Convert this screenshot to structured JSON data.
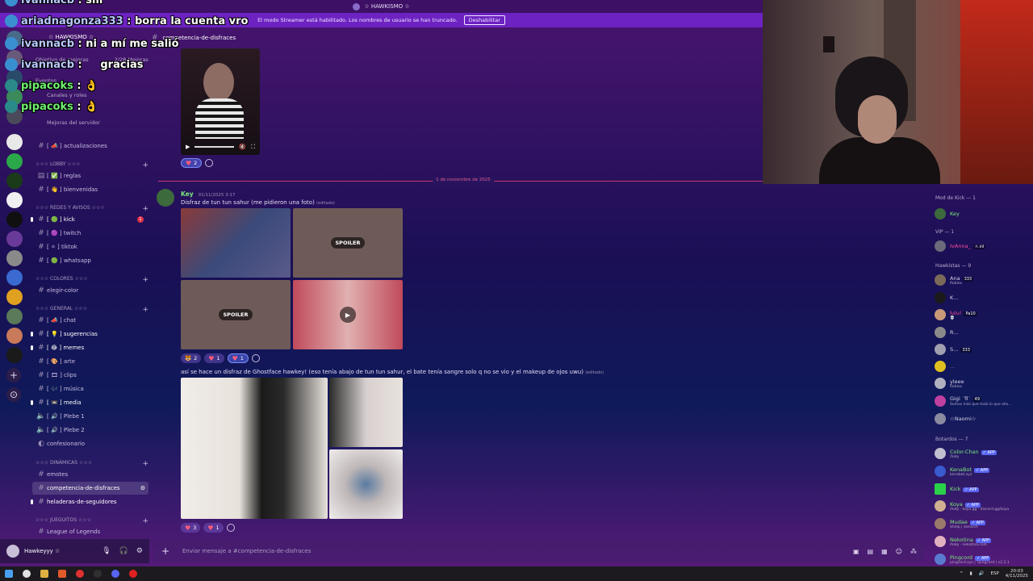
{
  "window": {
    "title": "☆ HAWKISMO ☆"
  },
  "streamer_bar": {
    "text": "El modo Streamer está habilitado. Los nombres de usuario se han truncado.",
    "button": "Deshabilitar"
  },
  "stream_chat": [
    {
      "user": "ivannacb",
      "text": "siii",
      "color": "blue"
    },
    {
      "user": "ariadnagonza333",
      "text": "borra la cuenta vro",
      "color": "blue"
    },
    {
      "user": "ivannacb",
      "text": "ni a mí me salió",
      "color": "blue"
    },
    {
      "user": "ivannacb",
      "text": "gracias",
      "color": "blue"
    },
    {
      "user": "pipacoks",
      "text": "👌",
      "color": "green"
    },
    {
      "user": "pipacoks",
      "text": "👌",
      "color": "green"
    }
  ],
  "server": {
    "name": "☆ HAWKISMO ☆",
    "nav": [
      {
        "label": "Objetivo de mejoras",
        "extra": "2/28 Mejoras"
      },
      {
        "label": "Eventos"
      },
      {
        "label": "Canales y roles"
      },
      {
        "label": "Mejoras del servidor"
      }
    ]
  },
  "channels": {
    "top": [
      {
        "label": "[ 📣 ] actualizaciones"
      }
    ],
    "categories": [
      {
        "name": "☆☆☆ LOBBY ☆☆☆",
        "items": [
          {
            "label": "[ ✅ ] reglas"
          },
          {
            "label": "[ 👋 ] bienvenidas"
          }
        ]
      },
      {
        "name": "☆☆☆ REDES Y AVISOS ☆☆☆",
        "items": [
          {
            "label": "[ 🟢 ] kick",
            "badge": "1"
          },
          {
            "label": "[ 🟣 ] twitch"
          },
          {
            "label": "[ ⚪ ] tiktok"
          },
          {
            "label": "[ 🟢 ] whatsapp"
          }
        ]
      },
      {
        "name": "☆☆☆ COLORES ☆☆☆",
        "items": [
          {
            "label": "elegir-color"
          }
        ]
      },
      {
        "name": "☆☆☆ GENERAL ☆☆☆",
        "items": [
          {
            "label": "[ 📣 ] chat"
          },
          {
            "label": "[ 💡 ] sugerencias"
          },
          {
            "label": "[ 😂 ] memes"
          },
          {
            "label": "[ 🎨 ] arte"
          },
          {
            "label": "[ 🎞 ] clips"
          },
          {
            "label": "[ 🎶 ] música"
          },
          {
            "label": "[ 📼 ] media"
          },
          {
            "label": "[ 🔊 ] Plebe 1"
          },
          {
            "label": "[ 🔊 ] Plebe 2"
          },
          {
            "label": "confesionario"
          }
        ]
      },
      {
        "name": "☆☆☆ DINÁMICAS ☆☆☆",
        "items": [
          {
            "label": "emotes"
          },
          {
            "label": "competencia-de-disfraces"
          },
          {
            "label": "heladeras-de-seguidores"
          }
        ]
      },
      {
        "name": "☆☆☆ JUEGUITOS ☆☆☆",
        "items": [
          {
            "label": "League of Legends"
          }
        ]
      }
    ]
  },
  "user_panel": {
    "name": "Hawkeyyy ☆"
  },
  "current_channel": "competencia-de-disfraces",
  "messages": {
    "video_reactions": [
      {
        "emoji": "♥",
        "count": "2"
      }
    ],
    "date_divider": "1 de noviembre de 2025",
    "author": "Key",
    "timestamp": "01/11/2025 3:17",
    "text1": "Disfraz de tun tun sahur (me pidieron una foto)",
    "edited": "(editado)",
    "spoiler": "SPOILER",
    "reactions1": [
      {
        "emoji": "🐯",
        "count": "2"
      },
      {
        "emoji": "♥",
        "count": "1"
      },
      {
        "emoji": "♥",
        "count": "1"
      }
    ],
    "text2": "así se hace un disfraz de Ghostface hawkey! (eso tenía abajo de tun tun sahur, el bate tenía sangre solo q no se vio y el makeup de ojos uwu)",
    "reactions2": [
      {
        "emoji": "♥",
        "count": "3"
      },
      {
        "emoji": "♥",
        "count": "1"
      }
    ]
  },
  "composer": {
    "placeholder": "Enviar mensaje a #competencia-de-disfraces"
  },
  "members": {
    "groups": [
      {
        "title": "Mod de Kick — 1",
        "members": [
          {
            "name": "Key",
            "color": "#7be87b"
          }
        ]
      },
      {
        "title": "VIP — 1",
        "members": [
          {
            "name": "IvAnna_",
            "color": "#ff4d9a",
            "tag": "☼.ılıl"
          }
        ]
      },
      {
        "title": "Hawkistas — 9",
        "members": [
          {
            "name": "Ana",
            "color": "#d8d0e8",
            "tag": "333",
            "status": "Roblox"
          },
          {
            "name": "K...",
            "color": "#d8d0e8"
          },
          {
            "name": "lulu!",
            "color": "#ff4d9a",
            "tag": "Pa10",
            "status": "💀"
          },
          {
            "name": "R...",
            "color": "#d8d0e8"
          },
          {
            "name": "S...",
            "color": "#d8d0e8",
            "tag": "333"
          },
          {
            "name": "...",
            "color": "#8a7cc0"
          },
          {
            "name": "yleee",
            "color": "#d8d0e8",
            "status": "Roblox"
          },
          {
            "name": "Gigi ˙𝔄˙",
            "color": "#d8d0e8",
            "tag": "49",
            "status": "Somos más que todo lo que ello..."
          },
          {
            "name": "☆Naomi☆",
            "color": "#d8d0e8"
          }
        ]
      },
      {
        "title": "Botardos — 7",
        "members": [
          {
            "name": "Color-Chan",
            "color": "#7be87b",
            "tag": "✓ APP",
            "status": "/help"
          },
          {
            "name": "KenaBot",
            "color": "#7be87b",
            "tag": "✓ APP",
            "status": "kenabot.xyz"
          },
          {
            "name": "Kick",
            "color": "#7be87b",
            "tag": "✓ APP"
          },
          {
            "name": "Koya",
            "color": "#7be87b",
            "tag": "✓ APP",
            "status": "/help · koya.gg · discord.gg/koya"
          },
          {
            "name": "Mudae",
            "color": "#7be87b",
            "tag": "✓ APP",
            "status": "$help | $search"
          },
          {
            "name": "Nekotina",
            "color": "#7be87b",
            "tag": "✓ APP",
            "status": "/help · nekotina.com"
          },
          {
            "name": "Pingcord",
            "color": "#7be87b",
            "tag": "✓ APP",
            "status": "pingcord.xyz | ?pingcord | v2.2.1"
          }
        ]
      }
    ]
  },
  "taskbar": {
    "lang": "ESP",
    "time": "20:03",
    "date": "4/11/2025"
  }
}
